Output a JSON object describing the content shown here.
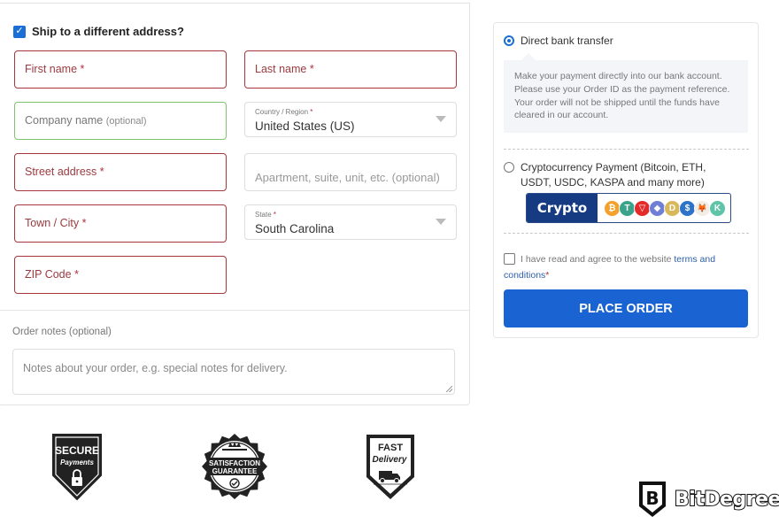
{
  "shipping": {
    "ship_different_label": "Ship to a different address?",
    "ship_different_checked": true,
    "fields": {
      "first_name": {
        "placeholder": "First name",
        "required": "*"
      },
      "last_name": {
        "placeholder": "Last name",
        "required": "*"
      },
      "company": {
        "placeholder": "Company name",
        "optional": "(optional)"
      },
      "country": {
        "label": "Country / Region",
        "required": "*",
        "value": "United States (US)"
      },
      "street": {
        "placeholder": "Street address",
        "required": "*"
      },
      "apartment": {
        "placeholder": "Apartment, suite, unit, etc. (optional)"
      },
      "city": {
        "placeholder": "Town / City",
        "required": "*"
      },
      "state": {
        "label": "State",
        "required": "*",
        "value": "South Carolina"
      },
      "zip": {
        "placeholder": "ZIP Code",
        "required": "*"
      }
    },
    "order_notes": {
      "label": "Order notes (optional)",
      "placeholder": "Notes about your order, e.g. special notes for delivery."
    }
  },
  "payment": {
    "options": [
      {
        "label": "Direct bank transfer",
        "selected": true,
        "description": "Make your payment directly into our bank account. Please use your Order ID as the payment reference. Your order will not be shipped until the funds have cleared in our account."
      },
      {
        "label": "Cryptocurrency Payment (Bitcoin, ETH, USDT, USDC, KASPA and many more)",
        "selected": false,
        "banner_word": "Crypto",
        "coins": [
          {
            "name": "bitcoin",
            "glyph": "₿",
            "color": "#f4a12a"
          },
          {
            "name": "tether",
            "glyph": "T",
            "color": "#3aa38a"
          },
          {
            "name": "tron",
            "glyph": "▽",
            "color": "#e52a2a"
          },
          {
            "name": "ethereum",
            "glyph": "◆",
            "color": "#6f7fd6"
          },
          {
            "name": "dogecoin",
            "glyph": "D",
            "color": "#d9b85a"
          },
          {
            "name": "usdc",
            "glyph": "$",
            "color": "#2f73c9"
          },
          {
            "name": "metamask",
            "glyph": "🦊",
            "color": "#f3ede5"
          },
          {
            "name": "kaspa",
            "glyph": "K",
            "color": "#5fc4a8"
          }
        ]
      }
    ],
    "terms": {
      "prefix": "I have read and agree to the website ",
      "link": "terms and conditions",
      "required": "*",
      "checked": false
    },
    "place_order_label": "PLACE ORDER",
    "colors": {
      "primary": "#1963d3",
      "error_border": "#a6383d",
      "valid_border": "#7ec46a"
    }
  },
  "badges": [
    {
      "name": "secure-payments",
      "line1": "SECURE",
      "line2": "Payments"
    },
    {
      "name": "satisfaction-guarantee",
      "line1": "SATISFACTION",
      "line2": "GUARANTEE"
    },
    {
      "name": "fast-delivery",
      "line1": "FAST",
      "line2": "Delivery"
    }
  ],
  "brand": {
    "name": "BitDegree",
    "mark": "B"
  }
}
